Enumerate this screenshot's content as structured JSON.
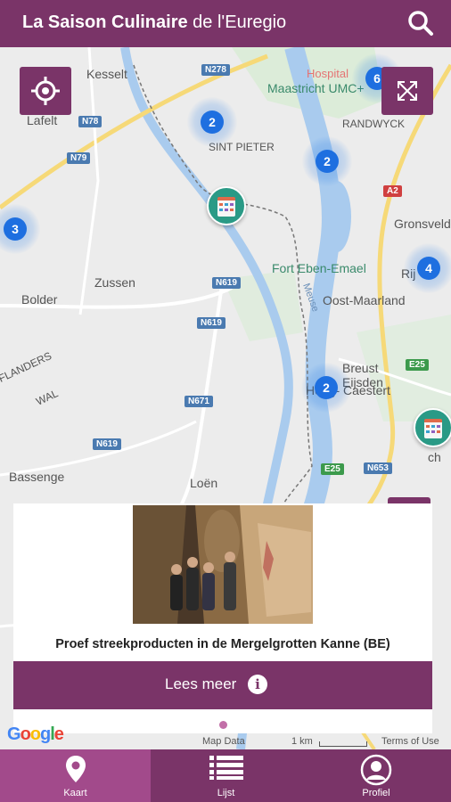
{
  "header": {
    "title_bold": "La Saison Culinaire",
    "title_rest": "de l'Euregio"
  },
  "map": {
    "places": {
      "kesselt": "Kesselt",
      "lafelt": "Lafelt",
      "hospital": "Hospital",
      "maastricht_umc": "Maastricht UMC+",
      "randwyck": "RANDWYCK",
      "sint_pieter": "SINT PIETER",
      "gronsveld": "Gronsveld",
      "rijckholt": "Rij",
      "fort": "Fort Eben-Emael",
      "bolder": "Bolder",
      "zussen": "Zussen",
      "oost_maarland": "Oost-Maarland",
      "flanders": "FLANDERS",
      "wal": "WAL",
      "breust": "Breust",
      "eijsden": "Eijsden",
      "hoog_caestert": "Hoog- Caestert",
      "bassenge": "Bassenge",
      "loen": "Loën",
      "ch": "ch",
      "meuse": "Meuse"
    },
    "roads": [
      "N278",
      "N78",
      "N79",
      "A2",
      "N619",
      "N619",
      "N671",
      "N619",
      "E25",
      "E25",
      "N653"
    ],
    "clusters": [
      "6",
      "2",
      "2",
      "3",
      "4",
      "2"
    ]
  },
  "card": {
    "caption": "Proef streekproducten in de Mergelgrotten Kanne (BE)",
    "button_label": "Lees meer",
    "info_glyph": "i"
  },
  "attribution": {
    "map_data": "Map Data",
    "scale": "1 km",
    "terms": "Terms of Use",
    "google": "Google"
  },
  "tabs": [
    {
      "label": "Kaart",
      "icon": "map-pin-icon",
      "active": true
    },
    {
      "label": "Lijst",
      "icon": "list-icon",
      "active": false
    },
    {
      "label": "Profiel",
      "icon": "profile-icon",
      "active": false
    }
  ],
  "colors": {
    "brand": "#7a3468",
    "brand_active": "#a24a8b",
    "cluster": "#1e6fe0",
    "calendar_pin": "#2a9a86"
  }
}
